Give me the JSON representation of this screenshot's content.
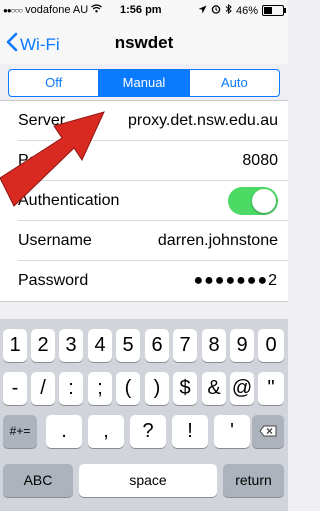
{
  "status_bar": {
    "carrier": "vodafone AU",
    "time": "1:56 pm",
    "battery": "46%",
    "battery_level": 0.46
  },
  "nav": {
    "back_label": "Wi-Fi",
    "title": "nswdet"
  },
  "segments": {
    "options": [
      "Off",
      "Manual",
      "Auto"
    ],
    "selected": "Manual"
  },
  "settings_rows": [
    {
      "label": "Server",
      "value": "proxy.det.nsw.edu.au"
    },
    {
      "label": "Port",
      "value": "8080"
    },
    {
      "label": "Authentication",
      "toggle_on": true
    },
    {
      "label": "Username",
      "value": "darren.johnstone"
    },
    {
      "label": "Password",
      "value": "●●●●●●●2"
    }
  ],
  "keyboard": {
    "row1": [
      "1",
      "2",
      "3",
      "4",
      "5",
      "6",
      "7",
      "8",
      "9",
      "0"
    ],
    "row2": [
      "-",
      "/",
      ":",
      ";",
      "(",
      ")",
      "$",
      "&",
      "@",
      "\""
    ],
    "row3": [
      ".",
      ",",
      "?",
      "!",
      "'"
    ],
    "symbols_key": "#+=",
    "abc_key": "ABC",
    "space_key": "space",
    "return_key": "return"
  },
  "colors": {
    "accent": "#0a7aff",
    "toggle_on": "#4cd964",
    "arrow": "#d92a22"
  }
}
